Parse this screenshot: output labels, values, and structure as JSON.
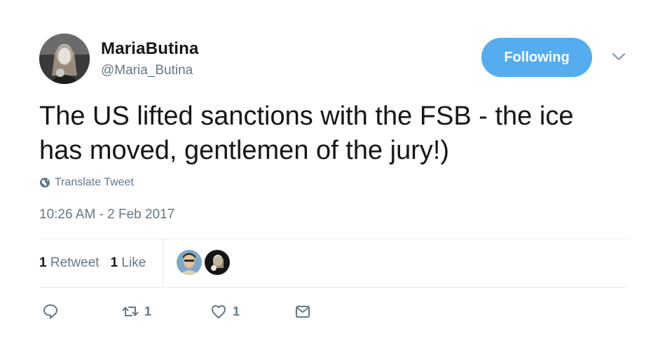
{
  "user": {
    "display_name": "MariaButina",
    "handle": "@Maria_Butina"
  },
  "follow_button": {
    "label": "Following",
    "color": "#55acee"
  },
  "tweet": {
    "text_line1": "The US lifted sanctions with the FSB - the ice",
    "text_line2": "has moved, gentlemen of the jury!)",
    "translate_label": "Translate Tweet",
    "timestamp": "10:26 AM - 2 Feb 2017"
  },
  "stats": {
    "retweet_count": "1",
    "retweet_label": "Retweet",
    "like_count": "1",
    "like_label": "Like"
  },
  "actions": {
    "reply_icon": "reply-icon",
    "retweet_icon": "retweet-icon",
    "retweet_count": "1",
    "like_icon": "heart-icon",
    "like_count": "1",
    "dm_icon": "envelope-icon"
  },
  "colors": {
    "text": "#14171a",
    "muted": "#657786",
    "divider": "#e6ecf0"
  }
}
